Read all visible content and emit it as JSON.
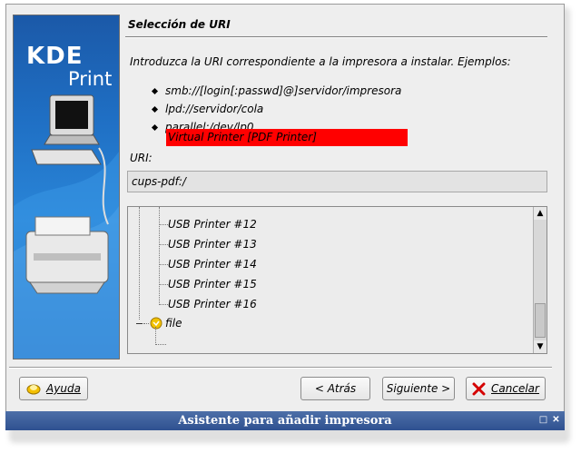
{
  "window": {
    "title": "Asistente para añadir impresora"
  },
  "side_panel": {
    "brand_kde": "KDE",
    "brand_print": "Print"
  },
  "page": {
    "title": "Selección de URI",
    "intro": "Introduzca la URI correspondiente a la impresora a instalar. Ejemplos:",
    "examples": [
      "smb://[login[:passwd]@]servidor/impresora",
      "lpd://servidor/cola",
      "parallel:/dev/lp0"
    ],
    "uri_label": "URI:",
    "uri_value": "cups-pdf:/"
  },
  "tree": {
    "items": [
      "USB Printer #12",
      "USB Printer #13",
      "USB Printer #14",
      "USB Printer #15",
      "USB Printer #16"
    ],
    "file_node": "file",
    "selected": "Virtual Printer [PDF Printer]"
  },
  "buttons": {
    "help": "Ayuda",
    "back": "< Atrás",
    "next": "Siguiente >",
    "cancel": "Cancelar"
  }
}
